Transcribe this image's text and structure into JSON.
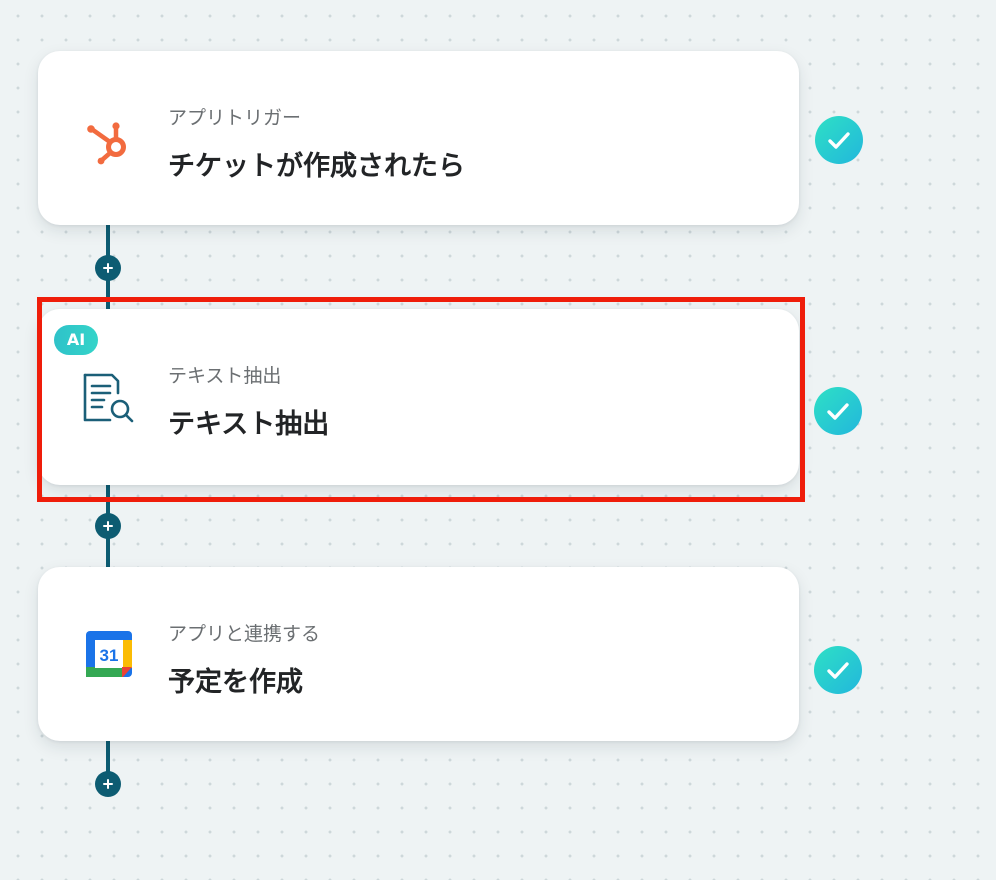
{
  "steps": [
    {
      "subtitle": "アプリトリガー",
      "title": "チケットが作成されたら",
      "icon": "hubspot-icon",
      "status": "complete"
    },
    {
      "badge": "AI",
      "subtitle": "テキスト抽出",
      "title": "テキスト抽出",
      "icon": "text-extraction-icon",
      "status": "complete"
    },
    {
      "subtitle": "アプリと連携する",
      "title": "予定を作成",
      "icon": "google-calendar-icon",
      "calendar_day": "31",
      "status": "complete"
    }
  ],
  "colors": {
    "hubspot": "#f26b3f",
    "connector": "#0d5c72",
    "check_gradient_start": "#2ee0c5",
    "check_gradient_end": "#22b7dc",
    "highlight": "#ef1d0a",
    "ai_badge": "#2fc2c9"
  }
}
